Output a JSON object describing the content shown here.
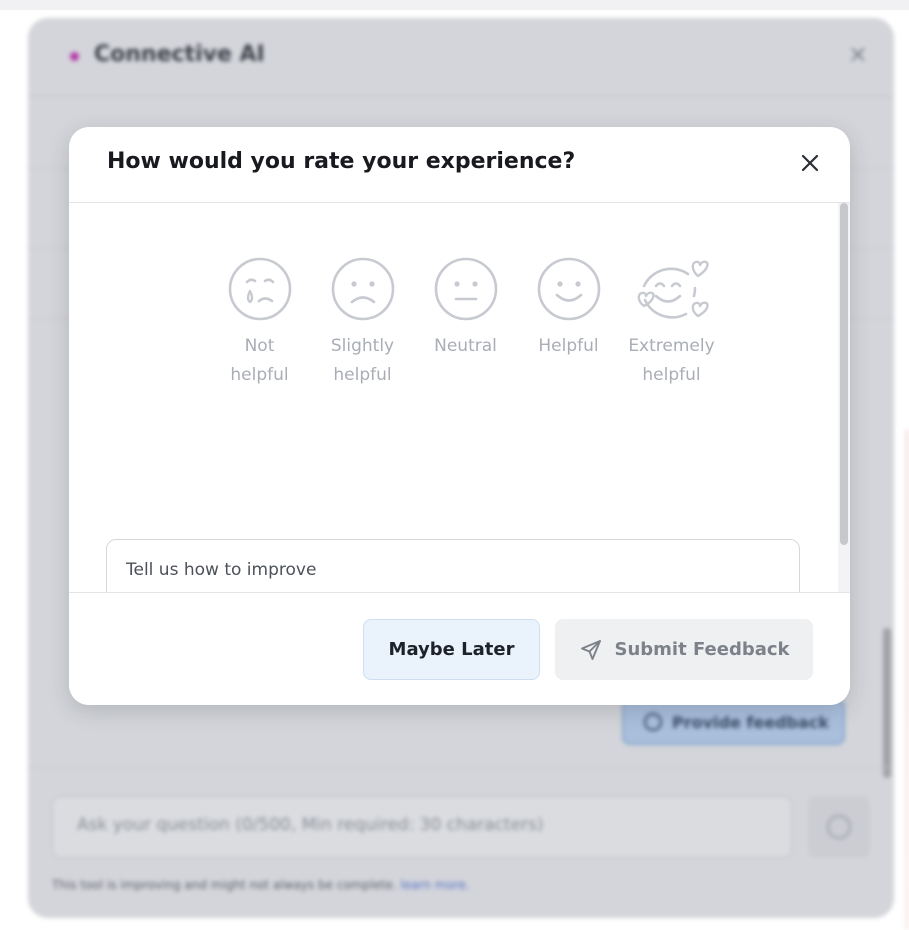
{
  "background_app": {
    "title": "Connective AI",
    "close_glyph": "×",
    "feedback_button_label": "Provide feedback",
    "question_placeholder": "Ask your question (0/500, Min required: 30 characters)",
    "disclaimer_text": "This tool is improving and might not always be complete. ",
    "disclaimer_link": "learn more.",
    "brand_color": "#b63aa8"
  },
  "modal": {
    "title": "How would you rate your experience?",
    "close_icon": "close-icon",
    "ratings": [
      {
        "label_line1": "Not",
        "label_line2": "helpful",
        "icon": "crying-face-icon"
      },
      {
        "label_line1": "Slightly",
        "label_line2": "helpful",
        "icon": "sad-face-icon"
      },
      {
        "label_line1": "Neutral",
        "label_line2": "",
        "icon": "neutral-face-icon"
      },
      {
        "label_line1": "Helpful",
        "label_line2": "",
        "icon": "smile-face-icon"
      },
      {
        "label_line1": "Extremely",
        "label_line2": "helpful",
        "icon": "love-face-icon"
      }
    ],
    "improve_placeholder": "Tell us how to improve",
    "maybe_later_label": "Maybe Later",
    "submit_label": "Submit Feedback",
    "submit_icon": "send-icon"
  },
  "colors": {
    "icon_gray": "#c7cad0",
    "label_gray": "#a9adb5",
    "secondary_button_bg": "#eaf3fc",
    "disabled_button_bg": "#eef0f2"
  }
}
